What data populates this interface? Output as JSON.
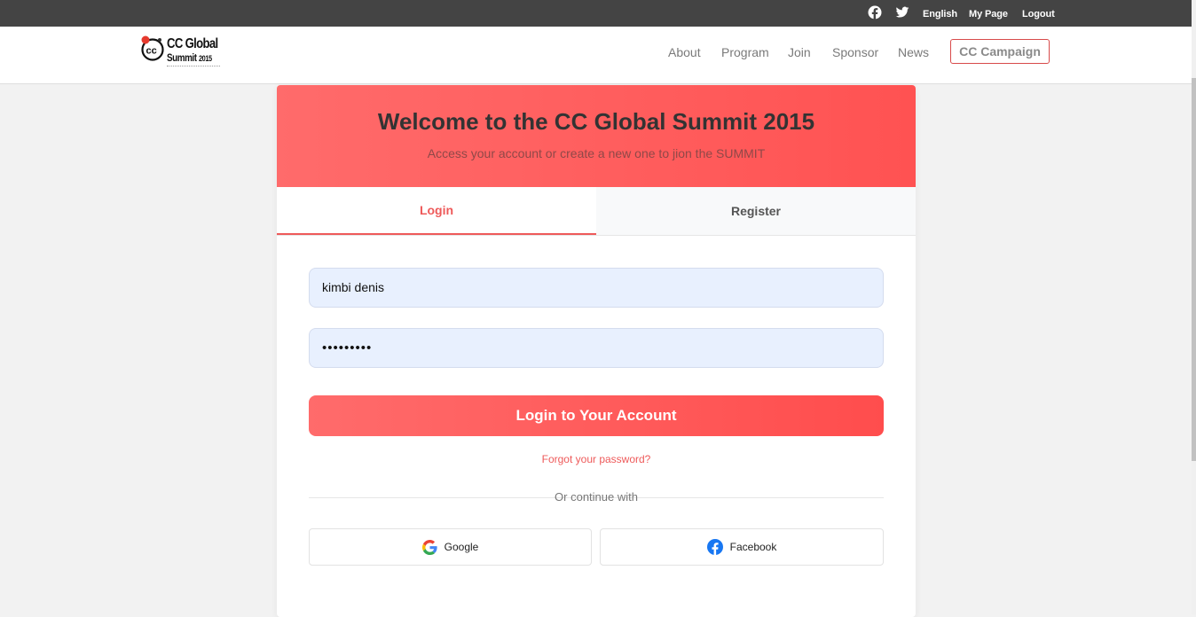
{
  "topbar": {
    "icons": [
      "facebook-icon",
      "twitter-icon"
    ],
    "links": [
      "English",
      "My Page",
      "Logout"
    ]
  },
  "header": {
    "logo": {
      "line1": "CC Global",
      "line2": "Summit",
      "year": "2015"
    },
    "nav": [
      "About",
      "Program",
      "Join",
      "Sponsor",
      "News"
    ],
    "cta": "CC Campaign"
  },
  "card": {
    "title": "Welcome to the CC Global Summit 2015",
    "subtitle": "Access your account or create a new one to jion the SUMMIT",
    "tabs": {
      "login": "Login",
      "register": "Register",
      "active": "login"
    },
    "username_value": "kimbi denis",
    "password_value": "•••••••••",
    "submit": "Login to Your Account",
    "forgot": "Forgot your password?",
    "divider_text": "Or continue with",
    "social": {
      "google": "Google",
      "facebook": "Facebook"
    }
  },
  "colors": {
    "accent": "#ee5a5a",
    "banner_start": "#ff6b6b",
    "banner_end": "#ff5252",
    "topbar": "#444444",
    "input_bg": "#e8f0fe"
  }
}
